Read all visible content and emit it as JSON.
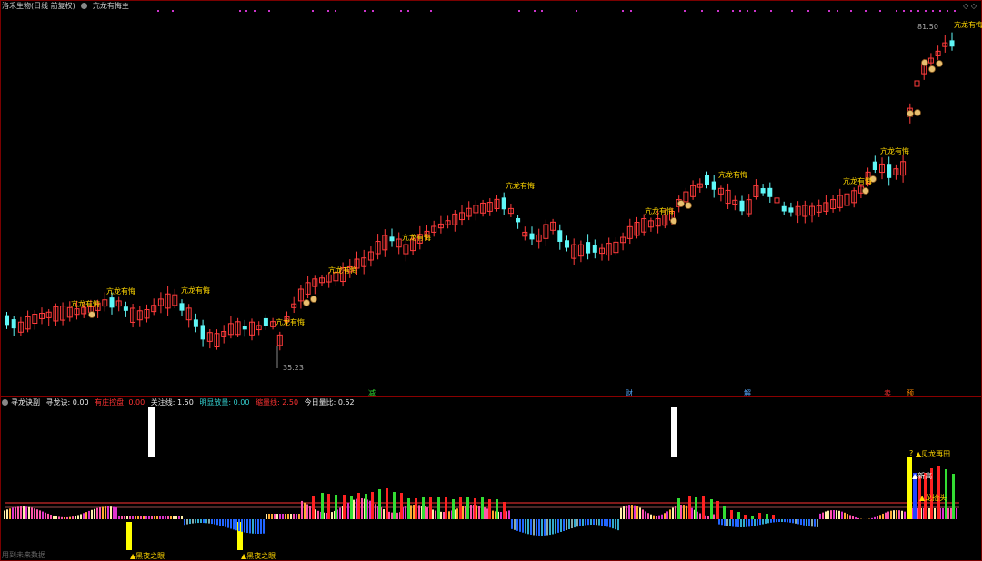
{
  "window": {
    "stock_label": "洛禾生物(日线 前复权)",
    "indicator_name": "亢龙有悔主",
    "corner_icons": "◇ ◇"
  },
  "main_chart": {
    "high_price_label": "81.50",
    "low_price_label": "35.23",
    "signal_label": "亢龙有悔",
    "bottom_markers": [
      {
        "text": "减",
        "color": "#33dd33"
      },
      {
        "text": "财",
        "color": "#55aaff"
      },
      {
        "text": "解",
        "color": "#55aaff"
      },
      {
        "text": "卖",
        "color": "#ff3333"
      },
      {
        "text": "预",
        "color": "#ff8800"
      }
    ],
    "colors": {
      "up": "#ff3b3b",
      "down": "#5ff7f7",
      "signal": "#ffd700",
      "purple_dots": "#cc33cc"
    }
  },
  "indicator": {
    "name": "寻龙诀副",
    "items": [
      {
        "label": "寻龙诀: 0.00",
        "color": "#e8e8e8"
      },
      {
        "label": "有庄控盘: 0.00",
        "color": "#ff3333"
      },
      {
        "label": "关注线: 1.50",
        "color": "#e8e8e8"
      },
      {
        "label": "明显放量: 0.00",
        "color": "#33cccc"
      },
      {
        "label": "缩量线: 2.50",
        "color": "#ff3333"
      },
      {
        "label": "今日量比: 0.52",
        "color": "#e8e8e8"
      }
    ],
    "annotations": {
      "dark_night_1": "▲黑夜之眼",
      "dark_night_2": "▲黑夜之眼",
      "see_dragon": "▲见龙再田",
      "new_high": "▲新高",
      "dragon_wake": "▲龙抬头"
    },
    "question_mark": "?"
  },
  "footer": {
    "text": "用到未来数据"
  }
}
